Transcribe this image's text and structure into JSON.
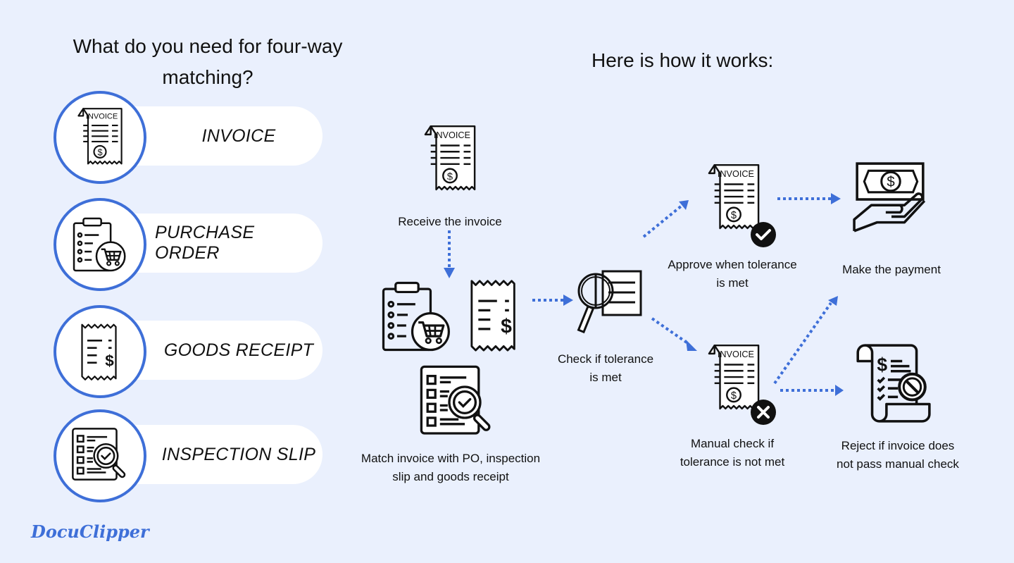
{
  "left_panel": {
    "title": "What do you need for four-way matching?",
    "items": [
      {
        "label": "INVOICE",
        "icon": "invoice-icon"
      },
      {
        "label": "PURCHASE ORDER",
        "icon": "purchase-order-icon"
      },
      {
        "label": "GOODS RECEIPT",
        "icon": "goods-receipt-icon"
      },
      {
        "label": "INSPECTION SLIP",
        "icon": "inspection-slip-icon"
      }
    ]
  },
  "right_panel": {
    "title": "Here is how it works:",
    "steps": {
      "receive": {
        "label": "Receive the invoice",
        "icon": "invoice-icon"
      },
      "match": {
        "label_line1": "Match invoice with PO, inspection",
        "label_line2": "slip and goods receipt",
        "icons": [
          "purchase-order-icon",
          "goods-receipt-icon",
          "inspection-slip-icon"
        ]
      },
      "check": {
        "label_line1": "Check if tolerance",
        "label_line2": "is met",
        "icon": "magnifier-document-icon"
      },
      "approve": {
        "label_line1": "Approve when tolerance",
        "label_line2": "is met",
        "icon": "invoice-approved-icon"
      },
      "manual": {
        "label_line1": "Manual check if",
        "label_line2": "tolerance is not met",
        "icon": "invoice-rejected-icon"
      },
      "payment": {
        "label": "Make the payment",
        "icon": "hand-money-icon"
      },
      "reject": {
        "label_line1": "Reject if invoice does",
        "label_line2": "not pass manual check",
        "icon": "reject-scroll-icon"
      }
    }
  },
  "brand": {
    "name": "DocuClipper"
  },
  "colors": {
    "accent": "#3e6fd8",
    "background": "#eaf0fd",
    "text": "#111111"
  }
}
